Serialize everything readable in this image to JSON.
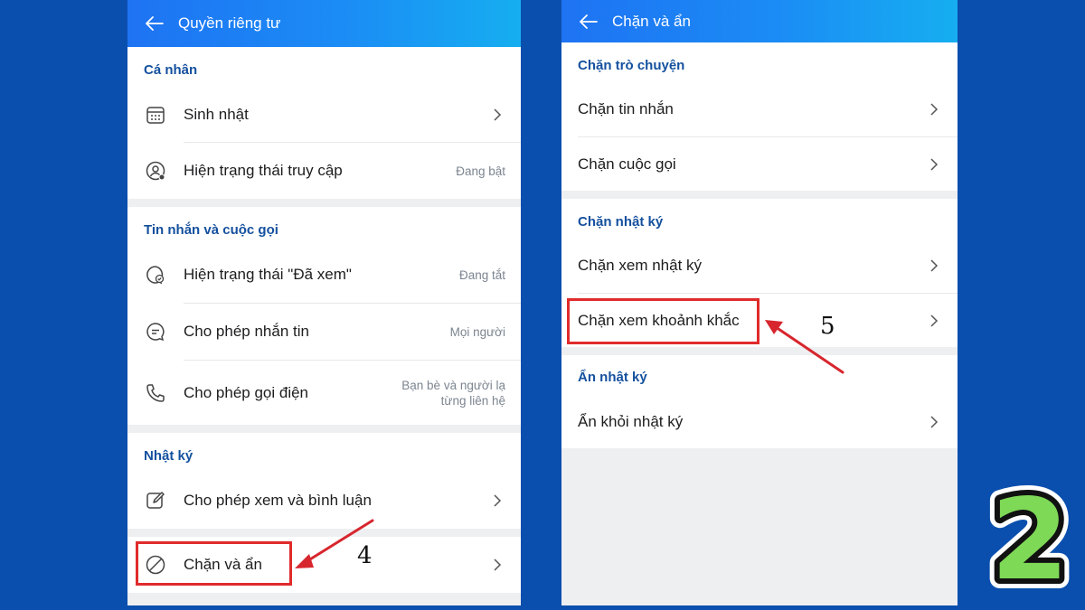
{
  "left_screen": {
    "title": "Quyền riêng tư",
    "sections": [
      {
        "title": "Cá nhân",
        "items": [
          {
            "label": "Sinh nhật",
            "icon": "calendar-icon",
            "value": ""
          },
          {
            "label": "Hiện trạng thái truy cập",
            "icon": "user-status-icon",
            "value": "Đang bật"
          }
        ]
      },
      {
        "title": "Tin nhắn và cuộc gọi",
        "items": [
          {
            "label": "Hiện trạng thái \"Đã xem\"",
            "icon": "seen-status-icon",
            "value": "Đang tắt"
          },
          {
            "label": "Cho phép nhắn tin",
            "icon": "chat-bubble-icon",
            "value": "Mọi người"
          },
          {
            "label": "Cho phép gọi điện",
            "icon": "phone-icon",
            "value_line1": "Bạn bè và người lạ",
            "value_line2": "từng liên hệ"
          }
        ]
      },
      {
        "title": "Nhật ký",
        "items": [
          {
            "label": "Cho phép xem và bình luận",
            "icon": "edit-icon",
            "value": ""
          }
        ]
      },
      {
        "items": [
          {
            "label": "Chặn và ẩn",
            "icon": "block-icon",
            "value": ""
          }
        ]
      }
    ]
  },
  "right_screen": {
    "title": "Chặn và ẩn",
    "sections": [
      {
        "title": "Chặn trò chuyện",
        "items": [
          {
            "label": "Chặn tin nhắn"
          },
          {
            "label": "Chặn cuộc gọi"
          }
        ]
      },
      {
        "title": "Chặn nhật ký",
        "items": [
          {
            "label": "Chặn xem nhật ký"
          },
          {
            "label": "Chặn xem khoảnh khắc"
          }
        ]
      },
      {
        "title": "Ẩn nhật ký",
        "items": [
          {
            "label": "Ẩn khỏi nhật ký"
          }
        ]
      }
    ]
  },
  "annotations": {
    "step_4": "4",
    "step_5": "5",
    "highlight_color": "#e02b2b",
    "arrow_color": "#d7262e"
  },
  "badge": {
    "number": "2",
    "fill_color": "#7ed957",
    "outline_color": "#111111"
  },
  "colors": {
    "background": "#0b4fae",
    "header_start": "#1e73f3",
    "header_end": "#16aef0",
    "section_title": "#14509e"
  }
}
